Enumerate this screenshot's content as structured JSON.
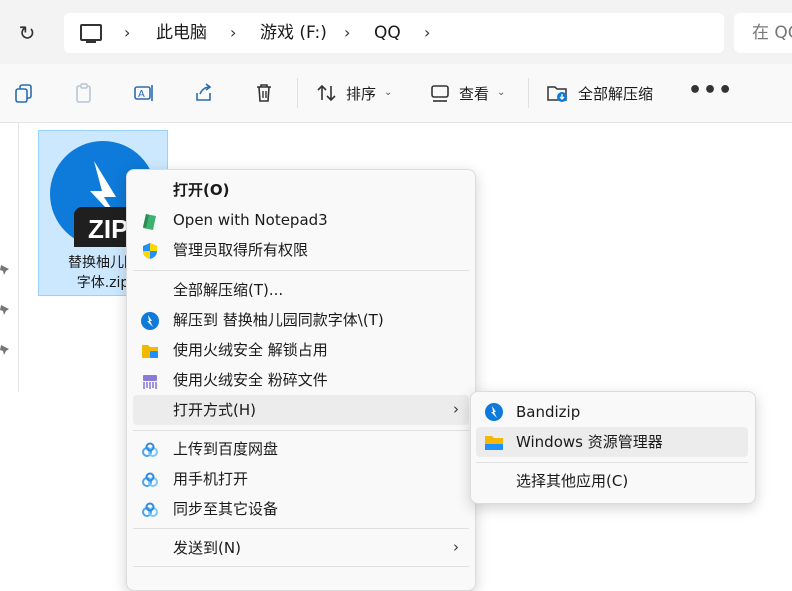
{
  "address_bar": {
    "refresh_icon": "refresh-icon",
    "breadcrumbs": [
      "此电脑",
      "游戏 (F:)",
      "QQ"
    ],
    "search_placeholder": "在 QQ"
  },
  "toolbar": {
    "sort_label": "排序",
    "view_label": "查看",
    "extract_all_label": "全部解压缩"
  },
  "file": {
    "name": "替换柚儿园同款字体.zip",
    "name_line1": "替换柚儿园",
    "name_line2": "字体.zip",
    "badge": "ZIP"
  },
  "context_menu": {
    "items": [
      {
        "label": "打开(O)",
        "bold": true
      },
      {
        "label": "Open with Notepad3",
        "icon": "notepad3-icon"
      },
      {
        "label": "管理员取得所有权限",
        "icon": "uac-shield-icon"
      },
      {
        "label": "全部解压缩(T)..."
      },
      {
        "label": "解压到 替换柚儿园同款字体\\(T)",
        "icon": "bandizip-icon"
      },
      {
        "label": "使用火绒安全 解锁占用",
        "icon": "huorong-unlock-icon"
      },
      {
        "label": "使用火绒安全 粉碎文件",
        "icon": "huorong-shred-icon"
      },
      {
        "label": "打开方式(H)",
        "has_submenu": true
      },
      {
        "label": "上传到百度网盘",
        "icon": "baidu-netdisk-icon"
      },
      {
        "label": "用手机打开",
        "icon": "baidu-netdisk-icon"
      },
      {
        "label": "同步至其它设备",
        "icon": "baidu-netdisk-icon"
      },
      {
        "label": "发送到(N)",
        "has_submenu": true
      }
    ]
  },
  "open_with_submenu": {
    "items": [
      {
        "label": "Bandizip",
        "icon": "bandizip-icon"
      },
      {
        "label": "Windows 资源管理器",
        "icon": "folder-icon"
      },
      {
        "label": "选择其他应用(C)"
      }
    ]
  },
  "colors": {
    "accent": "#0e7ad9",
    "selection": "#cce8ff",
    "menu_bg": "#f9f9f9"
  }
}
